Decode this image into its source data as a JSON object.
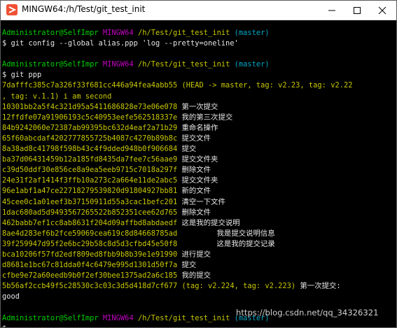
{
  "window": {
    "title": "MINGW64:/h/Test/git_test_init"
  },
  "prompt": {
    "user_host": "Administrator@SelfImpr",
    "shell": "MINGW64",
    "path": "/h/Test/git_test_init",
    "branch": "(master)"
  },
  "command1": "$ git config --global alias.ppp 'log --pretty=oneline'",
  "command2": "$ git ppp",
  "head_line": {
    "hash": "7dafffc385c7a326f33f681cc446a94fea4abb55",
    "decoration": "(HEAD -> master, tag: v2.23, tag: v2.22",
    "wrap": ", tag: v.1.1) i am second"
  },
  "log": [
    {
      "hash": "10301bb2a5f4c321d95a5411686828e73e06e078",
      "msg": "第一次提交"
    },
    {
      "hash": "12ffdfe07a91906193c5c40953eefe562518337e",
      "msg": "我的第三次提交"
    },
    {
      "hash": "84b9242060e72387ab99395bc632d4eaf2a71b29",
      "msg": "重命名操作"
    },
    {
      "hash": "65f60abcdaf4202777855725b4087c4270b89b8c",
      "msg": "提交文件"
    },
    {
      "hash": "8a38ad8c41798f598b43c4f9dded948b0f906684",
      "msg": "提交"
    },
    {
      "hash": "ba37d06431459b12a185fd8435da7fee7c56aae9",
      "msg": "提交文件夹"
    },
    {
      "hash": "c39d50ddf30e856ce8a9ea5eeb9715c7018a297f",
      "msg": "删除文件"
    },
    {
      "hash": "24e31f2af1414f3ffb10a273c2a664e11de2abc5",
      "msg": "提交文件夹"
    },
    {
      "hash": "96e1abf1a47ce22718279539820d91804927bb81",
      "msg": "新的文件"
    },
    {
      "hash": "45cee0c1a01eef3b37150911d55a3cac1befc201",
      "msg": "清空一下文件"
    },
    {
      "hash": "1dac680ad5d9493567265522b852351cee62d765",
      "msg": "删除文件"
    },
    {
      "hash": "462babb7ef1cc8ab8631f204d09affbd8abdaedf",
      "msg": "这是我的提交说明"
    },
    {
      "hash": "8ae4d283ef6b2fce59069cea619c8d84668785ad",
      "msg": "        我是提交说明信息"
    },
    {
      "hash": "39f259947d95f2e6bc29b58c8d5d3cfbd45e50f8",
      "msg": "        这是我的提交记录"
    },
    {
      "hash": "bca10206f57fd2edf809ed8fbb9b8b39e1e91990",
      "msg": "进行提交"
    },
    {
      "hash": "d8681e1bc67c81dda0f4c6479e995d1301d50f7a",
      "msg": "提交"
    },
    {
      "hash": "cfbe9e72a60eedb9b0f2ef30bee1375ad2a6c185",
      "msg": "我的提交"
    }
  ],
  "tagged_line": {
    "hash": "5b56af2ccb49f5c28530c3c03c3d5d418d7cf677",
    "decoration": "(tag: v2.224, tag: v2.223)",
    "msg": "第一次提交:",
    "wrap": "good"
  },
  "final_prompt": "$",
  "watermark": "https://blog.csdn.net/qq_34326321",
  "colors": {
    "green": "#00d000",
    "magenta": "#c000c0",
    "yellow": "#c8c800",
    "cyan": "#00a8c8",
    "text": "#c0c0c0",
    "background": "#000000"
  }
}
